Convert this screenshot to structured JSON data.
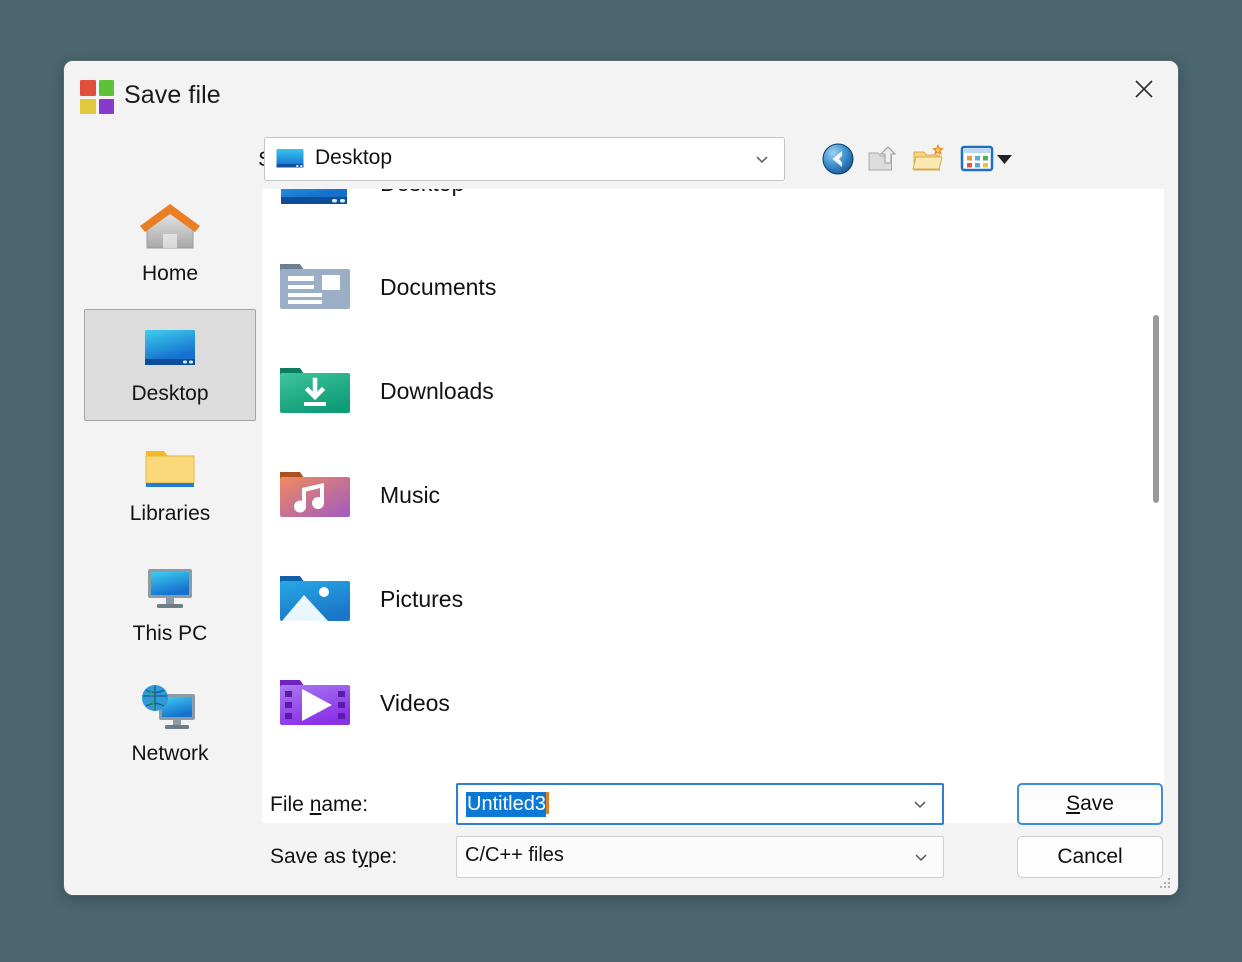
{
  "window": {
    "title": "Save file",
    "app_icon": "windows-logo-icon",
    "close_label": "×",
    "backdrop_color": "#4b6670",
    "accent_color": "#0a78d4"
  },
  "toolbar": {
    "savein_label": "Save in:",
    "savein_value": "Desktop",
    "buttons": [
      {
        "name": "back-button",
        "icon": "back-arrow-icon",
        "tooltip": "Back"
      },
      {
        "name": "up-folder-button",
        "icon": "up-folder-icon",
        "tooltip": "Up one level"
      },
      {
        "name": "new-folder-button",
        "icon": "new-folder-icon",
        "tooltip": "Create New Folder"
      },
      {
        "name": "views-button",
        "icon": "views-grid-icon",
        "tooltip": "Views"
      }
    ]
  },
  "places": [
    {
      "label": "Home",
      "icon": "home-icon",
      "selected": false
    },
    {
      "label": "Desktop",
      "icon": "desktop-icon",
      "selected": true
    },
    {
      "label": "Libraries",
      "icon": "libraries-icon",
      "selected": false
    },
    {
      "label": "This PC",
      "icon": "this-pc-icon",
      "selected": false
    },
    {
      "label": "Network",
      "icon": "network-icon",
      "selected": false
    }
  ],
  "file_list": [
    {
      "name": "Desktop",
      "icon": "desktop-folder-icon"
    },
    {
      "name": "Documents",
      "icon": "documents-folder-icon"
    },
    {
      "name": "Downloads",
      "icon": "downloads-folder-icon"
    },
    {
      "name": "Music",
      "icon": "music-folder-icon"
    },
    {
      "name": "Pictures",
      "icon": "pictures-folder-icon"
    },
    {
      "name": "Videos",
      "icon": "videos-folder-icon"
    }
  ],
  "form": {
    "filename_label_pre": "File ",
    "filename_label_mnemonic": "n",
    "filename_label_post": "ame:",
    "filename_value": "Untitled3",
    "filename_placeholder": "File name",
    "savetype_label_pre": "Save as t",
    "savetype_label_mnemonic": "y",
    "savetype_label_post": "pe:",
    "savetype_value": "C/C++ files"
  },
  "buttons": {
    "save_mnemonic": "S",
    "save_rest": "ave",
    "cancel_label": "Cancel"
  }
}
